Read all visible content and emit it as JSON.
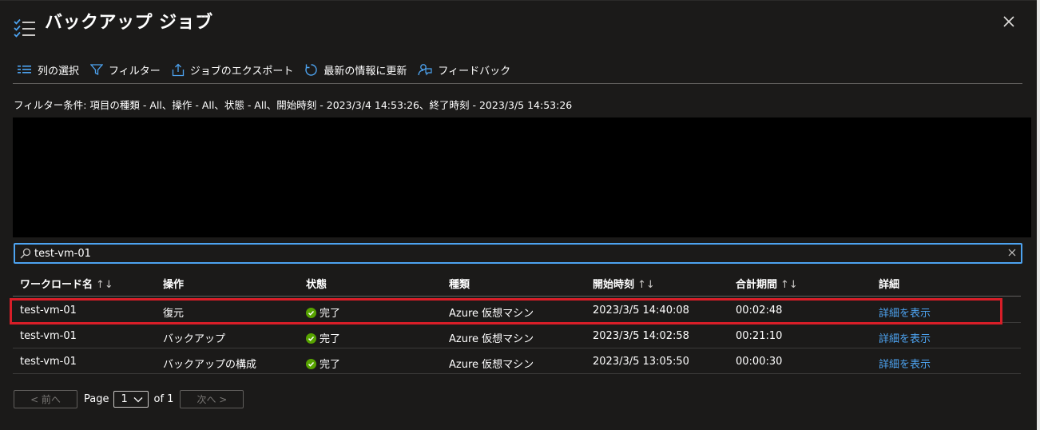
{
  "header": {
    "title": "バックアップ ジョブ",
    "more": "···"
  },
  "toolbar": {
    "columns_label": "列の選択",
    "filter_label": "フィルター",
    "export_label": "ジョブのエクスポート",
    "refresh_label": "最新の情報に更新",
    "feedback_label": "フィードバック"
  },
  "filter_summary": "フィルター条件: 項目の種類 - All、操作 - All、状態 - All、開始時刻 - 2023/3/4 14:53:26、終了時刻 - 2023/3/5 14:53:26",
  "search": {
    "value": "test-vm-01"
  },
  "table": {
    "headers": [
      "ワークロード名",
      "操作",
      "状態",
      "種類",
      "開始時刻",
      "合計期間",
      "詳細"
    ],
    "sort_glyph": "↑↓",
    "rows": [
      {
        "workload": "test-vm-01",
        "operation": "復元",
        "status": "完了",
        "type": "Azure 仮想マシン",
        "start": "2023/3/5 14:40:08",
        "duration": "00:02:48",
        "details": "詳細を表示"
      },
      {
        "workload": "test-vm-01",
        "operation": "バックアップ",
        "status": "完了",
        "type": "Azure 仮想マシン",
        "start": "2023/3/5 14:02:58",
        "duration": "00:21:10",
        "details": "詳細を表示"
      },
      {
        "workload": "test-vm-01",
        "operation": "バックアップの構成",
        "status": "完了",
        "type": "Azure 仮想マシン",
        "start": "2023/3/5 13:05:50",
        "duration": "00:00:30",
        "details": "詳細を表示"
      }
    ]
  },
  "pager": {
    "prev": "< 前へ",
    "page_label": "Page",
    "page_value": "1",
    "of_label": "of 1",
    "next": "次へ >"
  },
  "colors": {
    "accent": "#4da3f0",
    "success": "#57a300",
    "highlight": "#d81e28"
  }
}
